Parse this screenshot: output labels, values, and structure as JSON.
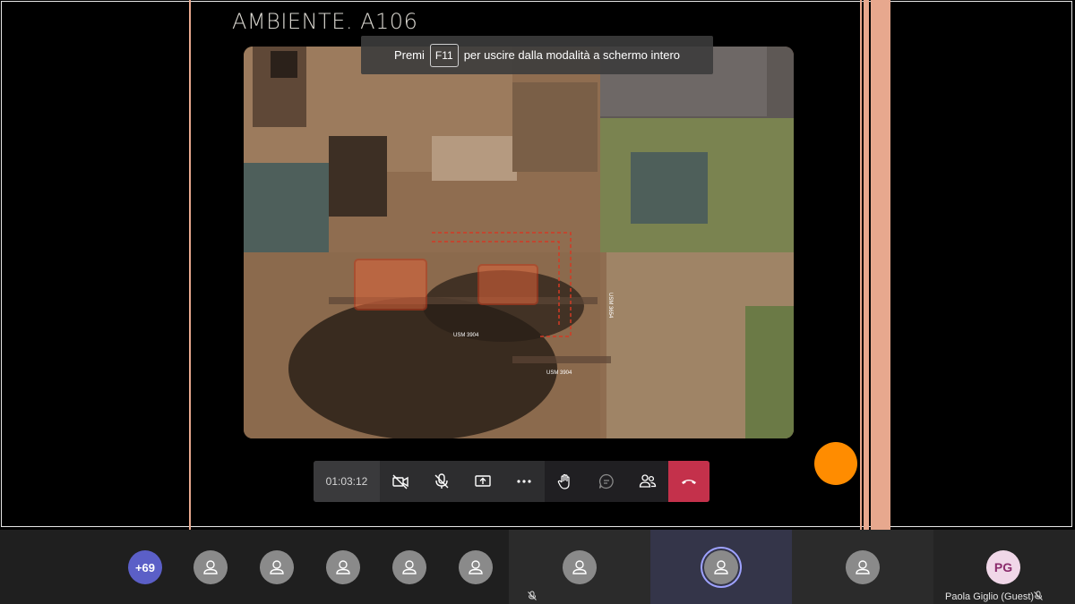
{
  "slide": {
    "title": "AMBIENTE. A106",
    "photo_labels": {
      "usm_3904_top": "USM 3904",
      "usm_3904_bottom": "USM 3904",
      "usm_side": "USM 3654"
    }
  },
  "fullscreen_toast": {
    "prefix": "Premi",
    "key": "F11",
    "suffix": "per uscire dalla modalità a schermo intero"
  },
  "call_controls": {
    "timer": "01:03:12",
    "buttons": [
      "camera-off",
      "mic-off",
      "share-screen",
      "more-actions",
      "raise-hand",
      "chat",
      "participants",
      "hang-up"
    ]
  },
  "participants": {
    "overflow_count": "+69",
    "named_participant": {
      "initials": "PG",
      "name": "Paola Giglio (Guest)"
    }
  },
  "colors": {
    "accent": "#5b5fc7",
    "hangup": "#c4314b",
    "orange_dot": "#ff8c00",
    "slide_border": "#e7a88e"
  }
}
